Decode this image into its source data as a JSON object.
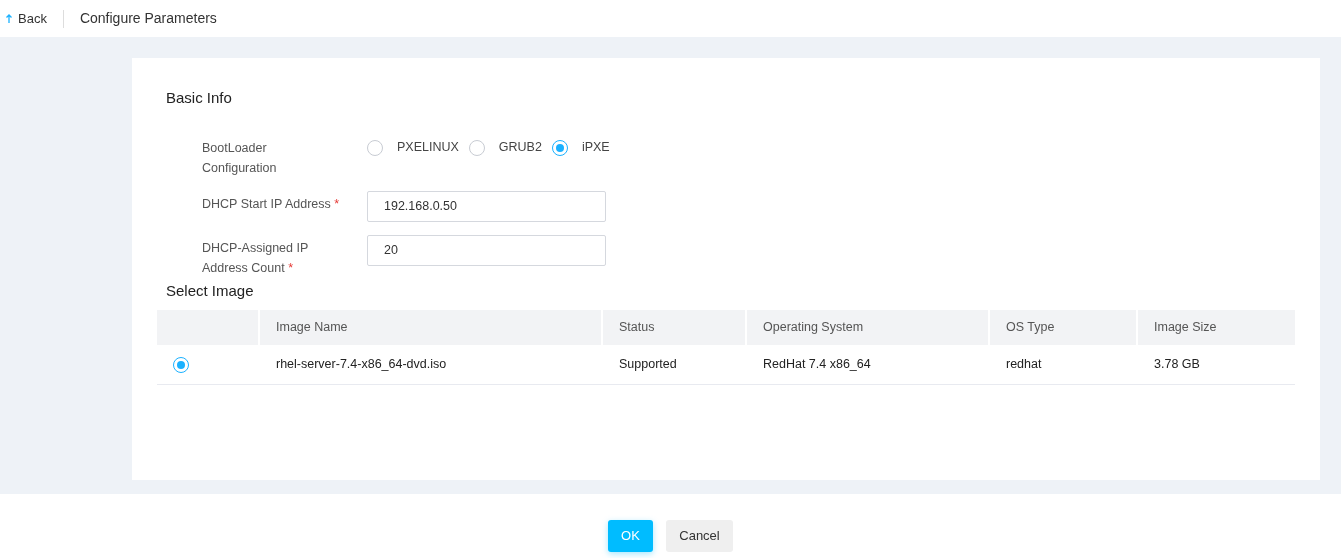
{
  "header": {
    "back": "Back",
    "title": "Configure Parameters"
  },
  "basic_info": {
    "title": "Basic Info",
    "bootloader": {
      "label": "BootLoader Configuration",
      "options": [
        {
          "label": "PXELINUX",
          "selected": false
        },
        {
          "label": "GRUB2",
          "selected": false
        },
        {
          "label": "iPXE",
          "selected": true
        }
      ]
    },
    "fields": [
      {
        "label": "DHCP Start IP Address",
        "required_mark": "*",
        "value": "192.168.0.50"
      },
      {
        "label": "DHCP-Assigned IP Address Count",
        "required_mark": "*",
        "value": "20"
      }
    ]
  },
  "select_image": {
    "title": "Select Image",
    "columns": [
      "Image Name",
      "Status",
      "Operating System",
      "OS Type",
      "Image Size"
    ],
    "rows": [
      {
        "selected": true,
        "cells": [
          "rhel-server-7.4-x86_64-dvd.iso",
          "Supported",
          "RedHat 7.4 x86_64",
          "redhat",
          "3.78 GB"
        ]
      }
    ]
  },
  "buttons": [
    {
      "label": "OK",
      "kind": "primary"
    },
    {
      "label": "Cancel",
      "kind": "secondary"
    }
  ]
}
